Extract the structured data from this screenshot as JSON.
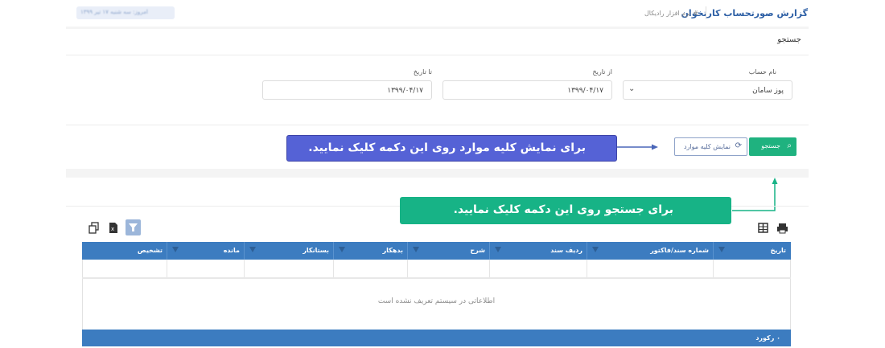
{
  "header": {
    "title": "گزارش صورتحساب کارتخوان",
    "breadcrumb": "# نرم افزار رادیکال",
    "user_pill": "امروز: سه شنبه ۱۷ تیر ۱۳۹۹"
  },
  "search_section": {
    "title": "جستجو"
  },
  "filters": {
    "account": {
      "label": "نام حساب",
      "value": "پوز سامان"
    },
    "from_date": {
      "label": "از تاریخ",
      "value": "۱۳۹۹/۰۴/۱۷"
    },
    "to_date": {
      "label": "تا تاریخ",
      "value": "۱۳۹۹/۰۴/۱۷"
    }
  },
  "actions": {
    "search_label": "جستجو",
    "show_all_label": "نمایش کلیه موارد"
  },
  "tooltips": {
    "show_all": "برای نمایش کلیه موارد روی این دکمه کلیک نمایید.",
    "search": "برای جستجو روی این دکمه کلیک نمایید."
  },
  "toolbar": {
    "icons": [
      "print-icon",
      "columns-icon",
      "filter-icon",
      "excel-icon",
      "copy-icon"
    ]
  },
  "grid": {
    "columns": [
      "تاریخ",
      "شماره سند/فاکتور",
      "ردیف سند",
      "شرح",
      "بدهکار",
      "بستانکار",
      "مانده",
      "تشخیص"
    ],
    "empty_message": "اطلاعاتی در سیستم تعریف نشده است",
    "footer": "۰ رکورد"
  },
  "colors": {
    "accent_blue": "#3c7cc0",
    "search_green": "#1fb27f",
    "tip_blue": "#5562d6",
    "tip_green": "#17b386"
  }
}
